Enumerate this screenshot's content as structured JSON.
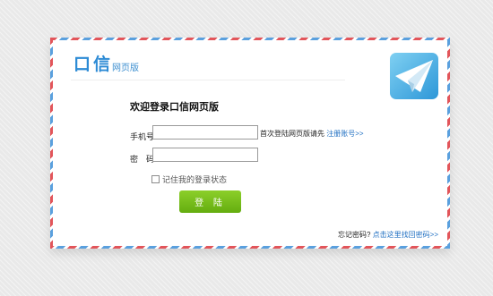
{
  "logo": {
    "name": "口信",
    "subtitle": "网页版"
  },
  "form": {
    "title": "欢迎登录口信网页版",
    "phone_label": "手机号",
    "phone_value": "",
    "password_label": "密　码",
    "password_value": "",
    "first_time_text": "首次登陆网页版请先",
    "register_link": "注册账号>>",
    "remember_label": "记住我的登录状态",
    "remember_checked": false,
    "login_button": "登 陆"
  },
  "footer": {
    "forgot_text": "忘记密码?",
    "recover_link": "点击这里找回密码>>"
  },
  "colors": {
    "brand_blue": "#2d8bd5",
    "button_green": "#64ad0f",
    "link_blue": "#1f6fc2",
    "stripe_red": "#e2555a",
    "stripe_blue": "#5aa0de"
  },
  "icons": [
    "paper-plane-icon",
    "checkbox-icon"
  ]
}
